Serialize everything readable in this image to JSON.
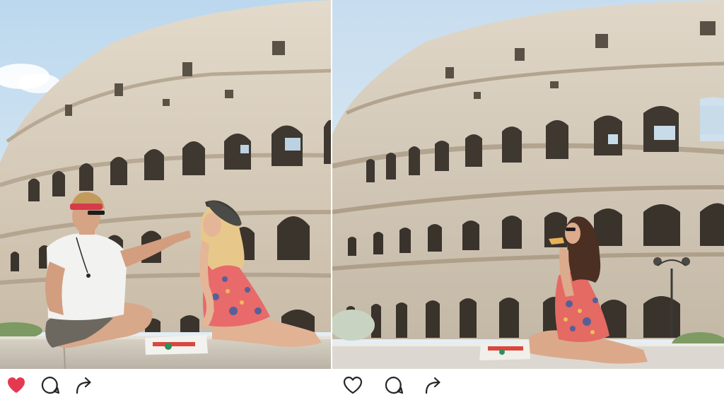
{
  "posts": [
    {
      "liked": true,
      "scene": "couple-sharing-pizza-at-colosseum",
      "icons": [
        "heart-filled-icon",
        "comment-icon",
        "share-icon"
      ],
      "colors": {
        "heart": "#e53950",
        "sky": "#cfe3f2",
        "stone": "#d4c7b3"
      }
    },
    {
      "liked": false,
      "scene": "woman-eating-pizza-alone-at-colosseum",
      "icons": [
        "heart-outline-icon",
        "comment-icon",
        "share-icon"
      ],
      "colors": {
        "heart": "#262626",
        "sky": "#d6e6f1",
        "stone": "#cfc4b4"
      }
    }
  ]
}
